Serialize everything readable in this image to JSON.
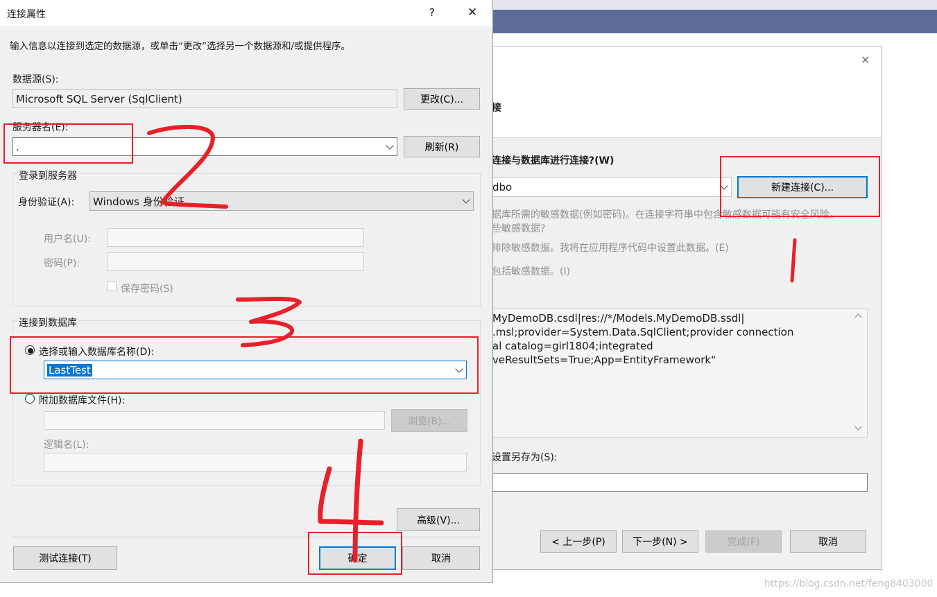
{
  "dialog": {
    "title": "连接属性",
    "help": "?",
    "close": "✕",
    "description": "输入信息以连接到选定的数据源，或单击“更改”选择另一个数据源和/或提供程序。",
    "datasource_label": "数据源(S):",
    "datasource_value": "Microsoft SQL Server (SqlClient)",
    "change_btn": "更改(C)...",
    "server_label": "服务器名(E):",
    "server_value": ".",
    "refresh_btn": "刷新(R)",
    "login_group": "登录到服务器",
    "auth_label": "身份验证(A):",
    "auth_value": "Windows 身份验证",
    "username_label": "用户名(U):",
    "password_label": "密码(P):",
    "save_password_label": "保存密码(S)",
    "connect_group": "连接到数据库",
    "select_db_label": "选择或输入数据库名称(D):",
    "db_value": "LastTest",
    "attach_label": "附加数据库文件(H):",
    "browse_btn": "浏览(B)...",
    "logical_label": "逻辑名(L):",
    "advanced_btn": "高级(V)...",
    "test_btn": "测试连接(T)",
    "ok_btn": "确定",
    "cancel_btn": "取消"
  },
  "wizard": {
    "close": "✕",
    "heading": "接",
    "question": "连接与数据库进行连接?(W)",
    "connection_value": "dbo",
    "new_conn_btn": "新建连接(C)...",
    "sensitive_line1": "据库所需的敏感数据(例如密码)。在连接字符串中包含敏感数据可能有安全风险。",
    "sensitive_line2": "些敏感数据?",
    "option_exclude": "排除敏感数据。我将在应用程序代码中设置此数据。(E)",
    "option_include": "包括敏感数据。(I)",
    "conn_string_lines": [
      "MyDemoDB.csdl|res://*/Models.MyDemoDB.ssdl|",
      ".msl;provider=System.Data.SqlClient;provider connection",
      "al catalog=girl1804;integrated",
      "veResultSets=True;App=EntityFramework\""
    ],
    "save_label": "设置另存为(S):",
    "prev_btn": "< 上一步(P)",
    "next_btn": "下一步(N) >",
    "finish_btn": "完成(F)",
    "cancel_btn": "取消"
  },
  "annotations": {
    "n1": "1",
    "n2": "2",
    "n3": "3",
    "n4": "4",
    "color": "#e8202a"
  },
  "watermark": "https://blog.csdn.net/feng8403000"
}
